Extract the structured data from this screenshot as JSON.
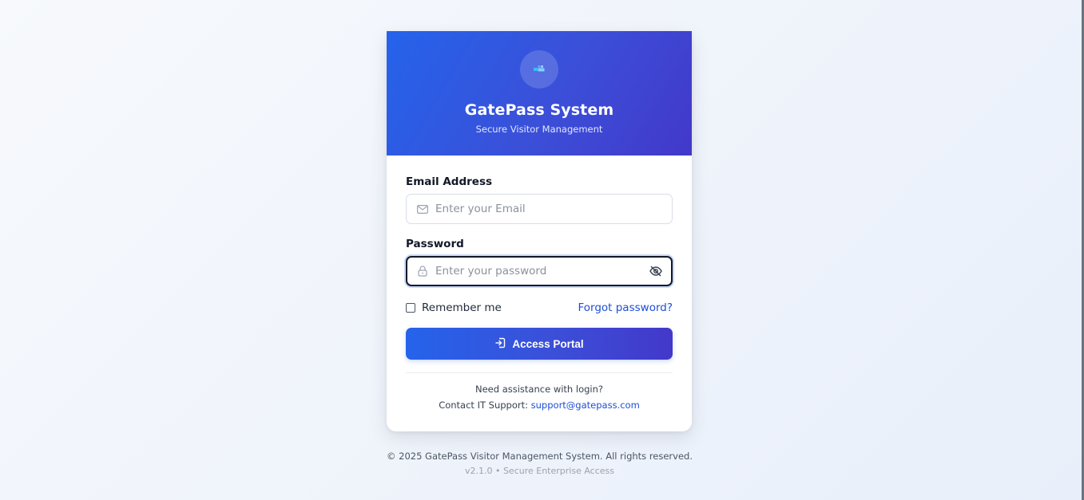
{
  "header": {
    "logo_icon": "building-icon",
    "title": "GatePass System",
    "subtitle": "Secure Visitor Management"
  },
  "form": {
    "email": {
      "label": "Email Address",
      "placeholder": "Enter your Email",
      "value": "",
      "icon": "envelope-icon"
    },
    "password": {
      "label": "Password",
      "placeholder": "Enter your password",
      "value": "",
      "icon": "lock-icon",
      "toggle_icon": "eye-off-icon"
    },
    "remember_label": "Remember me",
    "remember_checked": false,
    "forgot_label": "Forgot password?",
    "submit_label": "Access Portal",
    "submit_icon": "sign-in-icon"
  },
  "help": {
    "line1": "Need assistance with login?",
    "line2_prefix": "Contact IT Support:",
    "support_email": "support@gatepass.com"
  },
  "footer": {
    "copyright": "© 2025 GatePass Visitor Management System. All rights reserved.",
    "version": "v2.1.0 • Secure Enterprise Access"
  },
  "colors": {
    "primary": "#2563eb",
    "primary_end": "#4338ca",
    "link": "#1d4ed8"
  }
}
